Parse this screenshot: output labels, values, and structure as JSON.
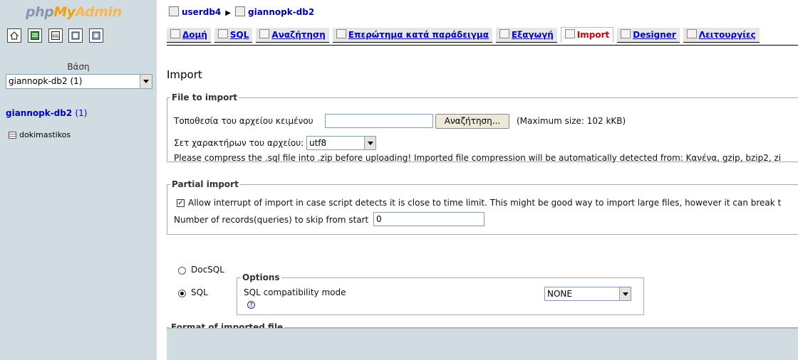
{
  "nav": {
    "logo": {
      "php": "php",
      "my": "My",
      "admin": "Admin"
    },
    "icons": [
      "home-icon",
      "query-window-icon",
      "sql-icon",
      "docs-icon",
      "help-icon"
    ],
    "db_label": "Βάση",
    "db_select": "giannopk-db2 (1)",
    "db_name": "giannopk-db2",
    "db_count": "(1)",
    "tables": [
      "dokimastikos"
    ]
  },
  "breadcrumb": {
    "server": "userdb4",
    "database": "giannopk-db2"
  },
  "tabs": [
    {
      "label": "Δομή",
      "icon": "structure-icon"
    },
    {
      "label": "SQL",
      "icon": "sql-icon"
    },
    {
      "label": "Αναζήτηση",
      "icon": "search-icon"
    },
    {
      "label": "Επερώτημα κατά παράδειγμα",
      "icon": "query-icon"
    },
    {
      "label": "Εξαγωγή",
      "icon": "export-icon"
    },
    {
      "label": "Import",
      "icon": "import-icon",
      "active": true
    },
    {
      "label": "Designer",
      "icon": "designer-icon"
    },
    {
      "label": "Λειτουργίες",
      "icon": "operations-icon"
    }
  ],
  "page_title": "Import",
  "file_section": {
    "legend": "File to import",
    "location_label": "Τοποθεσία του αρχείου κειμένου",
    "browse_button": "Αναζήτηση...",
    "max_size": "(Maximum size: 102 kKB)",
    "charset_label": "Σετ χαρακτήρων του αρχείου:",
    "charset_value": "utf8",
    "compress_note": "Please compress the .sql file into .zip before uploading! Imported file compression will be automatically detected from: Κανένα, gzip, bzip2, zi"
  },
  "partial_section": {
    "legend": "Partial import",
    "allow_interrupt": "Allow interrupt of import in case script detects it is close to time limit. This might be good way to import large files, however it can break t",
    "allow_interrupt_checked": true,
    "skip_label": "Number of records(queries) to skip from start",
    "skip_value": "0"
  },
  "format_section": {
    "legend": "Format of imported file",
    "docsql_label": "DocSQL",
    "sql_label": "SQL",
    "selected": "SQL",
    "options_legend": "Options",
    "compat_label": "SQL compatibility mode",
    "compat_value": "NONE"
  },
  "colors": {
    "nav_bg": "#d0dce0",
    "link": "#0000cc",
    "active_tab": "#cc0000"
  }
}
